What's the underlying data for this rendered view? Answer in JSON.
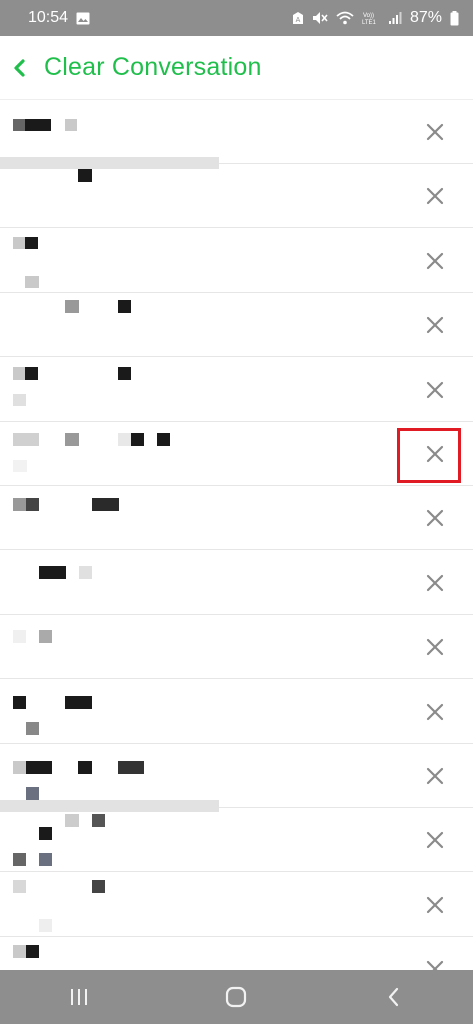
{
  "status_bar": {
    "time": "10:54",
    "battery": "87%",
    "icons": [
      "image-icon",
      "data-saver-icon",
      "mute-icon",
      "wifi-icon",
      "volte-icon",
      "signal-icon",
      "battery-icon"
    ],
    "volte_label": "Vo))\nLTE1"
  },
  "header": {
    "title": "Clear Conversation",
    "accent_color": "#20bf4c"
  },
  "list": {
    "conversations": [
      {
        "name": "",
        "clear_icon": "close-icon"
      },
      {
        "name": "",
        "clear_icon": "close-icon"
      },
      {
        "name": "",
        "clear_icon": "close-icon"
      },
      {
        "name": "",
        "clear_icon": "close-icon"
      },
      {
        "name": "",
        "clear_icon": "close-icon"
      },
      {
        "name": "",
        "clear_icon": "close-icon",
        "highlighted": true
      },
      {
        "name": "",
        "clear_icon": "close-icon"
      },
      {
        "name": "",
        "clear_icon": "close-icon"
      },
      {
        "name": "",
        "clear_icon": "close-icon"
      },
      {
        "name": "",
        "clear_icon": "close-icon"
      },
      {
        "name": "",
        "clear_icon": "close-icon"
      },
      {
        "name": "",
        "clear_icon": "close-icon"
      },
      {
        "name": "",
        "clear_icon": "close-icon"
      },
      {
        "name": "",
        "clear_icon": "close-icon"
      }
    ],
    "highlight_color": "#e01b24"
  },
  "nav_bar": {
    "buttons": [
      "recent-apps-icon",
      "home-icon",
      "back-icon"
    ]
  }
}
